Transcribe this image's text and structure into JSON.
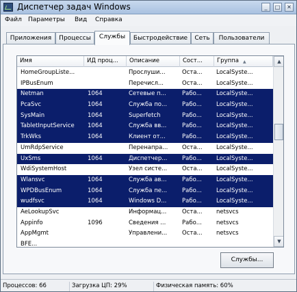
{
  "window": {
    "title": "Диспетчер задач Windows",
    "minimize": "_",
    "maximize": "□",
    "close": "✕"
  },
  "menu": [
    "Файл",
    "Параметры",
    "Вид",
    "Справка"
  ],
  "tabs": [
    "Приложения",
    "Процессы",
    "Службы",
    "Быстродействие",
    "Сеть",
    "Пользователи"
  ],
  "active_tab": "Службы",
  "columns": [
    "Имя",
    "ИД проц...",
    "Описание",
    "Сост...",
    "Группа"
  ],
  "sort_arrow": "▲",
  "services": [
    {
      "name": "HomeGroupListe...",
      "pid": "",
      "desc": "Прослуши...",
      "state": "Оста...",
      "group": "LocalSyste...",
      "selected": false
    },
    {
      "name": "IPBusEnum",
      "pid": "",
      "desc": "Перечисл...",
      "state": "Оста...",
      "group": "LocalSyste...",
      "selected": false
    },
    {
      "name": "Netman",
      "pid": "1064",
      "desc": "Сетевые п...",
      "state": "Рабо...",
      "group": "LocalSyste...",
      "selected": true
    },
    {
      "name": "PcaSvc",
      "pid": "1064",
      "desc": "Служба по...",
      "state": "Рабо...",
      "group": "LocalSyste...",
      "selected": true
    },
    {
      "name": "SysMain",
      "pid": "1064",
      "desc": "Superfetch",
      "state": "Рабо...",
      "group": "LocalSyste...",
      "selected": true
    },
    {
      "name": "TabletInputService",
      "pid": "1064",
      "desc": "Служба вв...",
      "state": "Рабо...",
      "group": "LocalSyste...",
      "selected": true
    },
    {
      "name": "TrkWks",
      "pid": "1064",
      "desc": "Клиент от...",
      "state": "Рабо...",
      "group": "LocalSyste...",
      "selected": true
    },
    {
      "name": "UmRdpService",
      "pid": "",
      "desc": "Перенапра...",
      "state": "Оста...",
      "group": "LocalSyste...",
      "selected": false
    },
    {
      "name": "UxSms",
      "pid": "1064",
      "desc": "Диспетчер...",
      "state": "Рабо...",
      "group": "LocalSyste...",
      "selected": true
    },
    {
      "name": "WdiSystemHost",
      "pid": "",
      "desc": "Узел систе...",
      "state": "Оста...",
      "group": "LocalSyste...",
      "selected": false
    },
    {
      "name": "Wlansvc",
      "pid": "1064",
      "desc": "Служба ав...",
      "state": "Рабо...",
      "group": "LocalSyste...",
      "selected": true
    },
    {
      "name": "WPDBusEnum",
      "pid": "1064",
      "desc": "Служба пе...",
      "state": "Рабо...",
      "group": "LocalSyste...",
      "selected": true
    },
    {
      "name": "wudfsvc",
      "pid": "1064",
      "desc": "Windows D...",
      "state": "Рабо...",
      "group": "LocalSyste...",
      "selected": true
    },
    {
      "name": "AeLookupSvc",
      "pid": "",
      "desc": "Информац...",
      "state": "Оста...",
      "group": "netsvcs",
      "selected": false
    },
    {
      "name": "Appinfo",
      "pid": "1096",
      "desc": "Сведения ...",
      "state": "Рабо...",
      "group": "netsvcs",
      "selected": false
    },
    {
      "name": "AppMgmt",
      "pid": "",
      "desc": "Управлени...",
      "state": "Оста...",
      "group": "netsvcs",
      "selected": false
    },
    {
      "name": "BFE...",
      "pid": "",
      "desc": "",
      "state": "",
      "group": "",
      "selected": false
    }
  ],
  "scrollbar": {
    "up": "▲",
    "down": "▼"
  },
  "services_button": "Службы...",
  "status": {
    "processes": "Процессов: 66",
    "cpu": "Загрузка ЦП: 29%",
    "memory": "Физическая память: 60%"
  },
  "colors": {
    "selection": "#0b1e6b",
    "selection_text": "#ffffff"
  }
}
